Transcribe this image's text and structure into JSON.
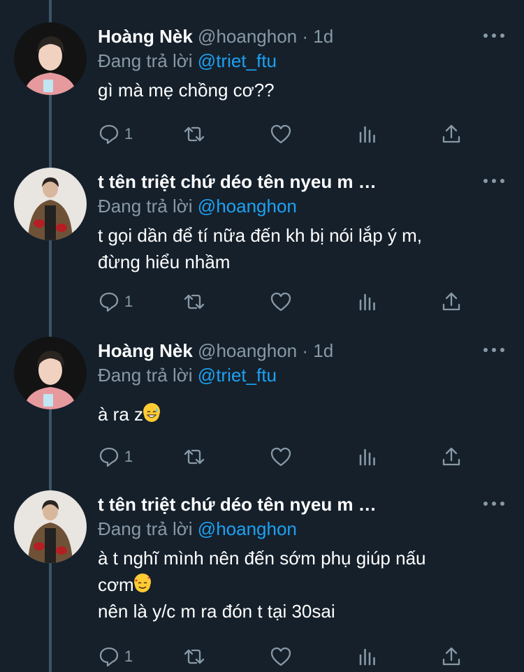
{
  "tweets": [
    {
      "name": "Hoàng Nèk",
      "handle": "@hoanghon",
      "dot": "·",
      "time": "1d",
      "replying_prefix": "Đang trả lời",
      "replying_to": "@triet_ftu",
      "body_lines": [
        "gì mà mẹ chồng cơ??"
      ],
      "reply_count": "1",
      "avatar": "avatar-pink-shirt"
    },
    {
      "name": "t tên triệt chứ déo tên nyeu m …",
      "handle": "",
      "dot": "",
      "time": "",
      "replying_prefix": "Đang trả lời",
      "replying_to": "@hoanghon",
      "body_lines": [
        "t gọi dần để tí nữa đến kh bị nói lắp ý m,",
        "đừng hiểu nhầm"
      ],
      "reply_count": "1",
      "avatar": "avatar-brown-jacket"
    },
    {
      "name": "Hoàng Nèk",
      "handle": "@hoanghon",
      "dot": "·",
      "time": "1d",
      "replying_prefix": "Đang trả lời",
      "replying_to": "@triet_ftu",
      "body_lines": [
        "à ra z"
      ],
      "body_emoji": "grinning-sweat-emoji",
      "reply_count": "1",
      "avatar": "avatar-pink-shirt"
    },
    {
      "name": "t tên triệt chứ déo tên nyeu m …",
      "handle": "",
      "dot": "",
      "time": "",
      "replying_prefix": "Đang trả lời",
      "replying_to": "@hoanghon",
      "body_lines": [
        "à t nghĩ mình nên đến sớm phụ giúp nấu",
        "cơm",
        "nên là y/c m ra đón t tại 30sai"
      ],
      "body_emoji": "smiling-hearts-emoji",
      "reply_count": "1",
      "avatar": "avatar-brown-jacket"
    }
  ],
  "icons": [
    "reply-icon",
    "retweet-icon",
    "like-icon",
    "analytics-icon",
    "share-icon",
    "more-icon"
  ],
  "colors": {
    "background": "#15202b",
    "text": "#ffffff",
    "muted": "#8899a6",
    "link": "#1da1f2",
    "thread_line": "#3d5466"
  }
}
